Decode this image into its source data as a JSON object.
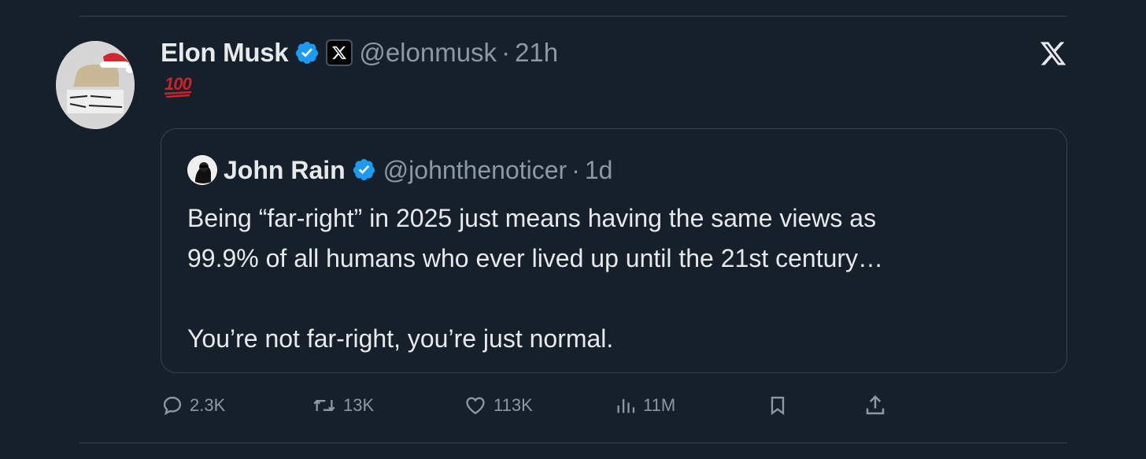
{
  "post": {
    "author_name": "Elon Musk",
    "author_handle": "@elonmusk",
    "separator": "·",
    "time": "21h",
    "text": "💯",
    "avatar_icon": "avatar-image",
    "verified_icon": "verified-badge-icon",
    "affiliation_icon": "x-affiliation-icon"
  },
  "quoted": {
    "author_name": "John Rain",
    "author_handle": "@johnthenoticer",
    "separator": "·",
    "time": "1d",
    "line1": "Being “far-right” in 2025 just means having the same views as",
    "line2": "99.9% of all humans who ever lived up until the 21st century…",
    "line3": "You’re not far-right, you’re just normal."
  },
  "actions": {
    "replies": "2.3K",
    "reposts": "13K",
    "likes": "113K",
    "views": "11M"
  },
  "colors": {
    "background": "#15202b",
    "text": "#e7e9ea",
    "muted": "#8b98a5",
    "border": "#38444d",
    "verified": "#1d9bf0"
  }
}
